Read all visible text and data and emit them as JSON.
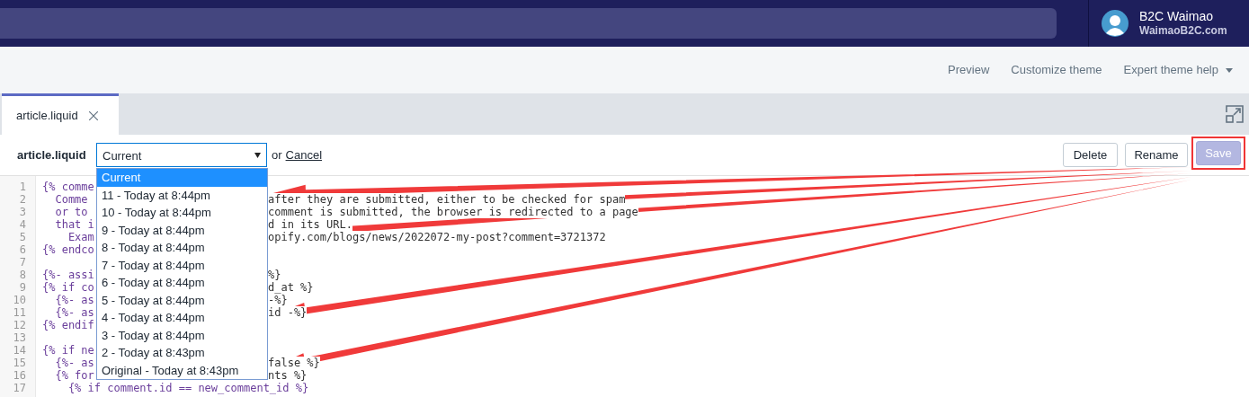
{
  "user": {
    "name": "B2C Waimao",
    "site": "WaimaoB2C.com"
  },
  "top_links": [
    {
      "label": "Preview",
      "has_caret": false
    },
    {
      "label": "Customize theme",
      "has_caret": false
    },
    {
      "label": "Expert theme help",
      "has_caret": true
    }
  ],
  "tabs": [
    {
      "label": "article.liquid",
      "selected": true
    }
  ],
  "toolbar": {
    "file_name": "article.liquid",
    "version_select": {
      "value": "Current",
      "expanded": true,
      "options": [
        {
          "label": "Current",
          "selected": true
        },
        {
          "label": "11 - Today at 8:44pm",
          "selected": false
        },
        {
          "label": "10 - Today at 8:44pm",
          "selected": false
        },
        {
          "label": "9 - Today at 8:44pm",
          "selected": false
        },
        {
          "label": "8 - Today at 8:44pm",
          "selected": false
        },
        {
          "label": "7 - Today at 8:44pm",
          "selected": false
        },
        {
          "label": "6 - Today at 8:44pm",
          "selected": false
        },
        {
          "label": "5 - Today at 8:44pm",
          "selected": false
        },
        {
          "label": "4 - Today at 8:44pm",
          "selected": false
        },
        {
          "label": "3 - Today at 8:44pm",
          "selected": false
        },
        {
          "label": "2 - Today at 8:43pm",
          "selected": false
        },
        {
          "label": "Original - Today at 8:43pm",
          "selected": false
        }
      ]
    },
    "or_text": "or",
    "cancel_link": "Cancel",
    "buttons": [
      {
        "label": "Delete",
        "disabled": false,
        "highlighted": false
      },
      {
        "label": "Rename",
        "disabled": false,
        "highlighted": false
      },
      {
        "label": "Save",
        "disabled": true,
        "highlighted": true
      }
    ]
  },
  "editor": {
    "lines": [
      {
        "number": "1",
        "left": "{% comme"
      },
      {
        "number": "2",
        "left": "  Comme",
        "right": "after they are submitted, either to be checked for spam"
      },
      {
        "number": "3",
        "left": "  or to",
        "right": "comment is submitted, the browser is redirected to a page"
      },
      {
        "number": "4",
        "left": "  that i",
        "right": "d in its URL."
      },
      {
        "number": "5",
        "left": "    Exam",
        "right": "opify.com/blogs/news/2022072-my-post?comment=3721372"
      },
      {
        "number": "6",
        "left": "{% endco"
      },
      {
        "number": "7"
      },
      {
        "number": "8",
        "left": "{%- assi",
        "right": "%}"
      },
      {
        "number": "9",
        "left": "{% if co",
        "right": "d_at %}"
      },
      {
        "number": "10",
        "left": "  {%- as",
        "right": "-%}"
      },
      {
        "number": "11",
        "left": "  {%- as",
        "right": "id -%}"
      },
      {
        "number": "12",
        "left": "{% endif"
      },
      {
        "number": "13"
      },
      {
        "number": "14",
        "left": "{% if ne"
      },
      {
        "number": "15",
        "left": "  {%- as",
        "right": "false %}"
      },
      {
        "number": "16",
        "left": "  {% for",
        "right": "nts %}"
      },
      {
        "number": "17",
        "left": "    {% if comment.id == new_comment_id %}"
      }
    ]
  }
}
